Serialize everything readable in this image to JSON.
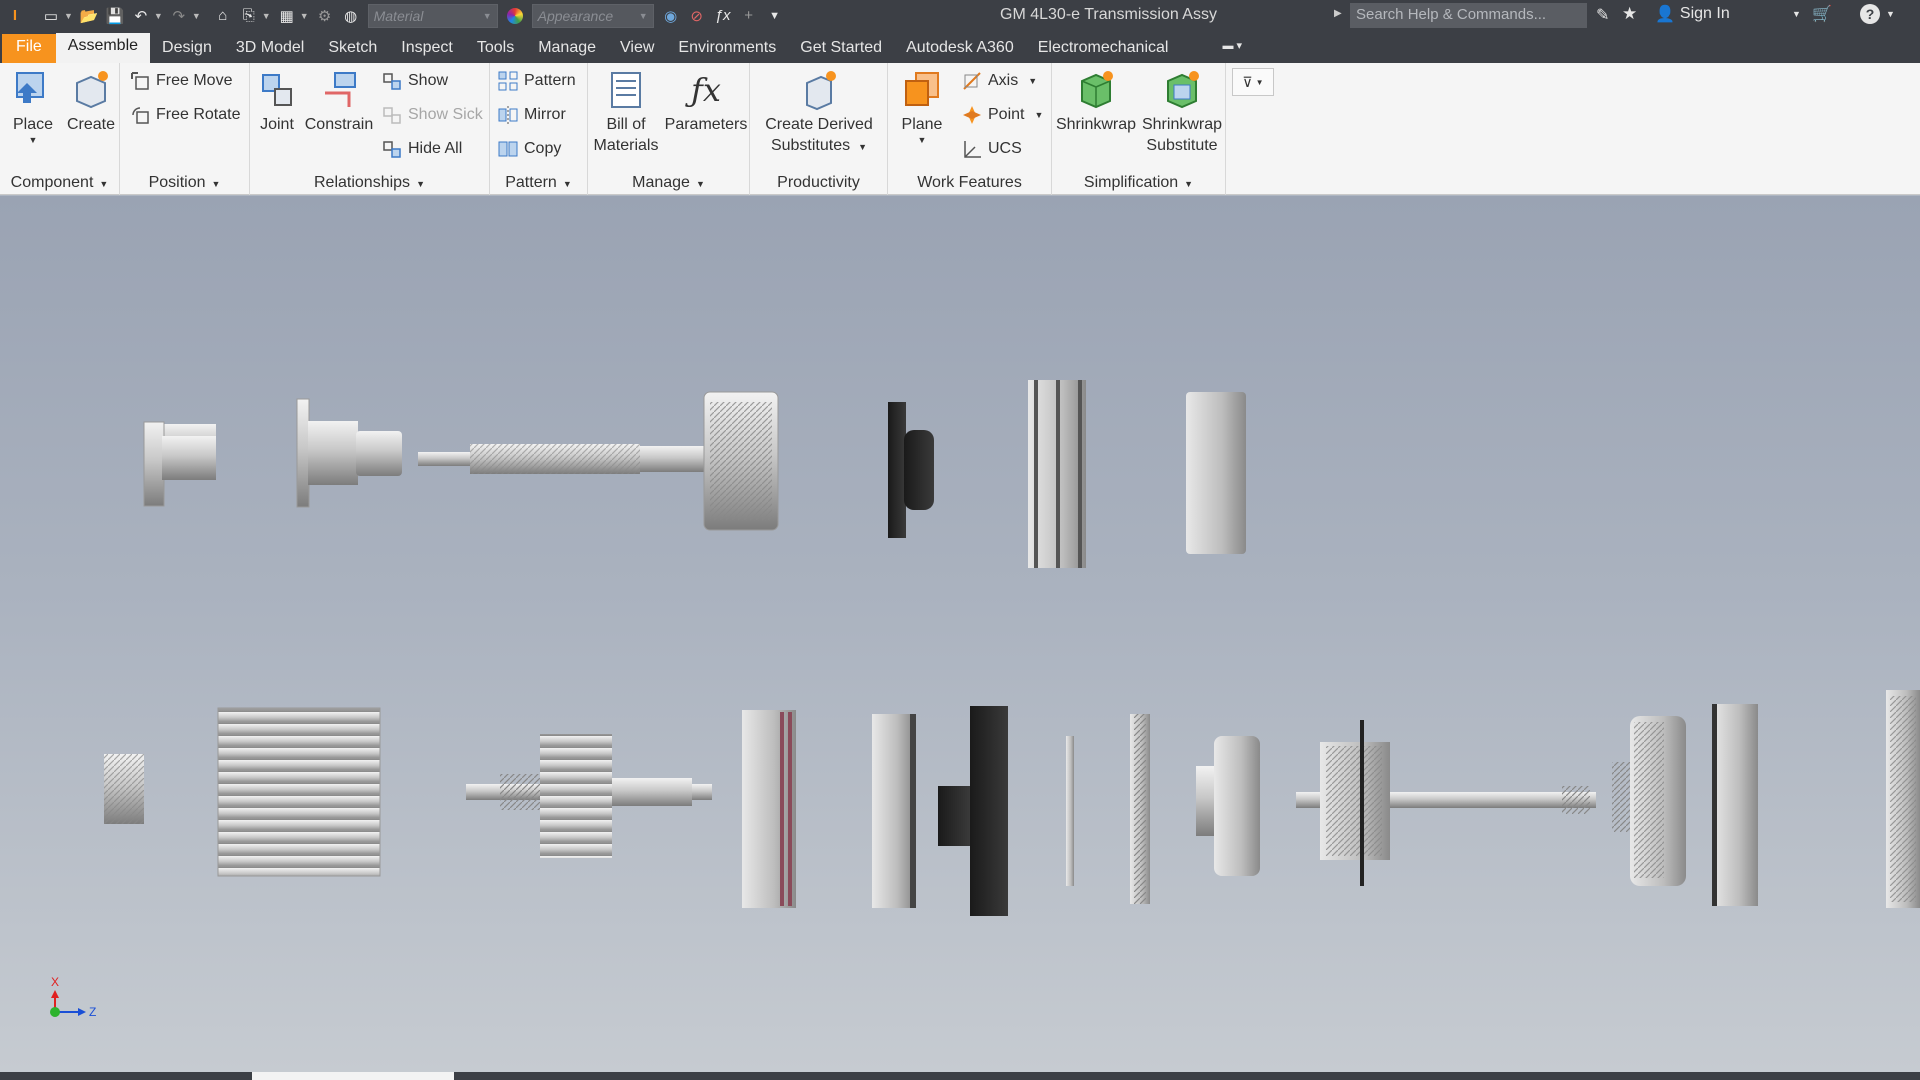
{
  "qat": {
    "material": "Material",
    "appearance": "Appearance",
    "title": "GM 4L30-e Transmission Assy",
    "search_placeholder": "Search Help & Commands...",
    "sign_in": "Sign In"
  },
  "tabs": [
    "File",
    "Assemble",
    "Design",
    "3D Model",
    "Sketch",
    "Inspect",
    "Tools",
    "Manage",
    "View",
    "Environments",
    "Get Started",
    "Autodesk A360",
    "Electromechanical"
  ],
  "ribbon": {
    "component": {
      "label": "Component",
      "place": "Place",
      "create": "Create"
    },
    "position": {
      "label": "Position",
      "free_move": "Free Move",
      "free_rotate": "Free Rotate"
    },
    "relationships": {
      "label": "Relationships",
      "joint": "Joint",
      "constrain": "Constrain",
      "show": "Show",
      "show_sick": "Show Sick",
      "hide_all": "Hide All"
    },
    "pattern": {
      "label": "Pattern",
      "pattern": "Pattern",
      "mirror": "Mirror",
      "copy": "Copy"
    },
    "manage": {
      "label": "Manage",
      "bom_l1": "Bill of",
      "bom_l2": "Materials",
      "parameters": "Parameters"
    },
    "productivity": {
      "label": "Productivity",
      "derived_l1": "Create Derived",
      "derived_l2": "Substitutes"
    },
    "work_features": {
      "label": "Work Features",
      "plane": "Plane",
      "axis": "Axis",
      "point": "Point",
      "ucs": "UCS"
    },
    "simplification": {
      "label": "Simplification",
      "shrinkwrap": "Shrinkwrap",
      "sws_l1": "Shrinkwrap",
      "sws_l2": "Substitute"
    }
  },
  "triad": {
    "x": "X",
    "z": "Z"
  },
  "colors": {
    "file_tab": "#f7931e",
    "chrome": "#3c3f45",
    "ribbon": "#f5f5f5",
    "triad_x": "#e02020",
    "triad_z": "#1a4fd6",
    "triad_origin": "#2db32d"
  }
}
